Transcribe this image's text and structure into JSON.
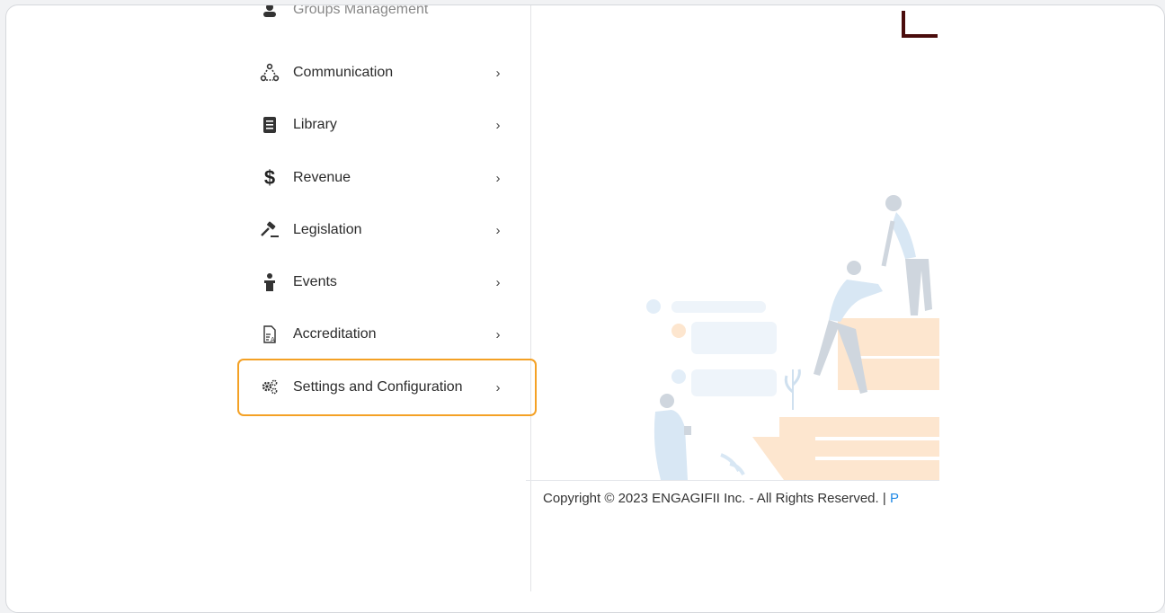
{
  "sidebar": {
    "items": [
      {
        "label": "Groups Management",
        "icon": "groups-icon"
      },
      {
        "label": "Communication",
        "icon": "communication-icon"
      },
      {
        "label": "Library",
        "icon": "library-icon"
      },
      {
        "label": "Revenue",
        "icon": "dollar-icon"
      },
      {
        "label": "Legislation",
        "icon": "gavel-icon"
      },
      {
        "label": "Events",
        "icon": "events-icon"
      },
      {
        "label": "Accreditation",
        "icon": "accreditation-icon"
      },
      {
        "label": "Settings and Configuration",
        "icon": "gears-icon"
      }
    ],
    "chevron": "›"
  },
  "footer": {
    "copyright": "Copyright © 2023 ENGAGIFII Inc. - All Rights Reserved. | ",
    "link": "P"
  },
  "colors": {
    "highlight": "#f4a125",
    "link": "#1e88e5",
    "corner_mark": "#4a0c0c"
  }
}
